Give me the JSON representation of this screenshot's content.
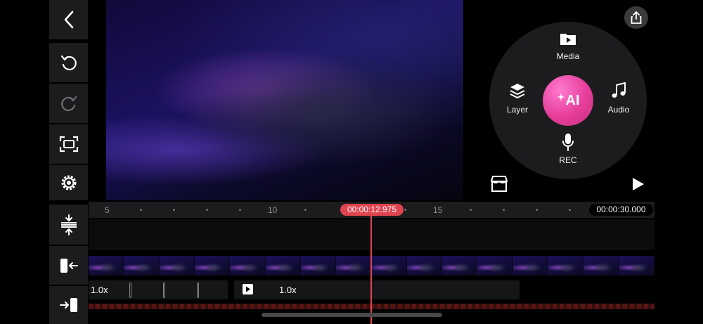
{
  "preview": {
    "description_icon": "particle-wave-video-frame"
  },
  "wheel": {
    "media_label": "Media",
    "layer_label": "Layer",
    "audio_label": "Audio",
    "rec_label": "REC",
    "ai_label": "AI"
  },
  "timeline": {
    "ruler_labels": [
      "5",
      "10",
      "15"
    ],
    "current_time": "00:00:12.975",
    "total_time": "00:00:30.000",
    "clip1_speed": "1.0x",
    "clip2_speed": "1.0x"
  },
  "colors": {
    "accent": "#e0444f",
    "ai_gradient": "#e53d99",
    "panel": "#1c1c1e"
  }
}
